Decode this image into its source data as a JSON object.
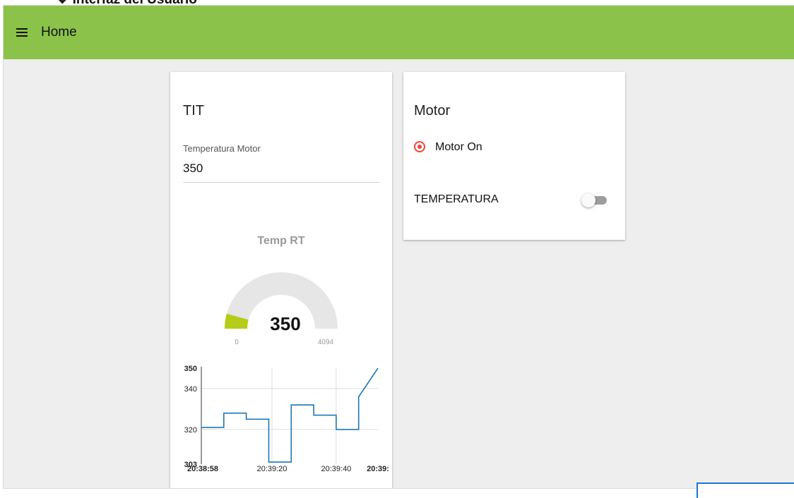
{
  "document": {
    "bullet_text": "Interfaz del Usuario"
  },
  "toolbar": {
    "title": "Home",
    "color": "#8bc34a"
  },
  "tit_card": {
    "title": "TIT",
    "field_label": "Temperatura Motor",
    "field_value": "350",
    "gauge": {
      "title": "Temp RT",
      "value": 350,
      "min": 0,
      "max": 4094,
      "value_text": "350",
      "min_text": "0",
      "max_text": "4094",
      "fill_color": "#b5cc18",
      "track_color": "#e6e6e6"
    }
  },
  "motor_card": {
    "title": "Motor",
    "radio_label": "Motor On",
    "radio_selected": true,
    "switch_label": "TEMPERATURA",
    "switch_on": false,
    "accent_color": "#f44336"
  },
  "chart_data": {
    "type": "line",
    "step": true,
    "ylim": [
      303,
      350
    ],
    "y_ticks": [
      "303",
      "320",
      "340",
      "350"
    ],
    "x_ticks": [
      "20:38:58",
      "20:39:20",
      "20:39:40",
      "20:39:"
    ],
    "x_tick_positions": [
      58,
      80,
      100,
      113
    ],
    "xlim": [
      58,
      113
    ],
    "series": [
      {
        "color": "#1f77b4",
        "x": [
          58,
          65,
          65,
          72,
          72,
          79,
          79,
          86,
          86,
          93,
          93,
          100,
          100,
          107,
          107,
          113
        ],
        "values": [
          321,
          321,
          328,
          328,
          325,
          325,
          304,
          304,
          332,
          332,
          327,
          327,
          320,
          320,
          336,
          350
        ]
      }
    ]
  }
}
